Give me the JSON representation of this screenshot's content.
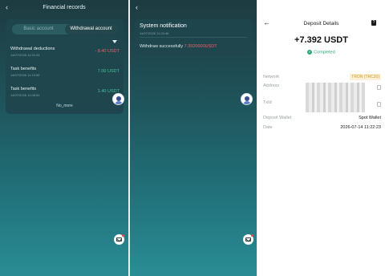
{
  "screen1": {
    "title": "Financial records",
    "tabs": {
      "basic": "Basic account",
      "withdrawal": "Withdrawal account"
    },
    "records": [
      {
        "name": "Withdrawal deductions",
        "date": "14/07/2026 11:20:43",
        "amount": "- 8.40 USDT",
        "kind": "negative"
      },
      {
        "name": "Task benefits",
        "date": "14/07/2026 11:19:50",
        "amount": "7.00 USDT",
        "kind": "positive"
      },
      {
        "name": "Task benefits",
        "date": "14/07/2026 11:08:04",
        "amount": "1.40 USDT",
        "kind": "positive"
      }
    ],
    "no_more": "No_more"
  },
  "screen2": {
    "notification": {
      "title": "System notification",
      "date": "14/07/2026 11:20:46",
      "message_prefix": "Withdraw successfully ",
      "message_amount": "7.3920000USDT"
    }
  },
  "screen3": {
    "title": "Deposit Details",
    "help_icon_glyph": "?",
    "amount": "+7.392 USDT",
    "status": "Completed",
    "network_label": "Network",
    "network_badge": "TRON (TRC20)",
    "address_label": "Address",
    "txid_label": "TxId",
    "deposit_wallet_label": "Deposit Wallet",
    "deposit_wallet_value": "Spot Wallet",
    "date_label": "Date",
    "date_value": "2026-07-14 11:22:23"
  },
  "colors": {
    "background_top": "#1d3b40",
    "background_bottom": "#2a8d95",
    "negative": "#e06767",
    "positive": "#45c39a",
    "completed": "#2fa877",
    "network_badge": "#cf9a21"
  },
  "icons": {
    "back": "back-arrow-icon",
    "dropdown": "caret-down-icon",
    "avatar": "support-avatar-icon",
    "mail": "mail-icon",
    "help": "help-book-icon",
    "status": "check-circle-icon",
    "copy": "copy-icon"
  }
}
